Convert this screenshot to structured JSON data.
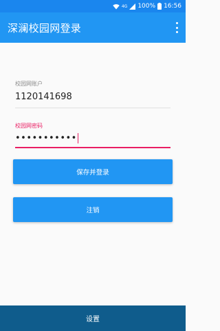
{
  "status_bar": {
    "network": "4G",
    "battery": "100%",
    "time": "16:56"
  },
  "app_bar": {
    "title": "深澜校园网登录",
    "overflow_icon": "more-vert-icon"
  },
  "account_field": {
    "label": "校园网账户",
    "value": "1120141698"
  },
  "password_field": {
    "label": "校园网密码",
    "value": "•••••••••••"
  },
  "buttons": {
    "save_login": "保存并登录",
    "logout": "注销"
  },
  "bottom_bar": {
    "settings": "设置"
  },
  "colors": {
    "primary": "#2196f3",
    "status_bar": "#1a86ee",
    "accent": "#e91e63",
    "bottom_bar": "#0f5c8c"
  }
}
